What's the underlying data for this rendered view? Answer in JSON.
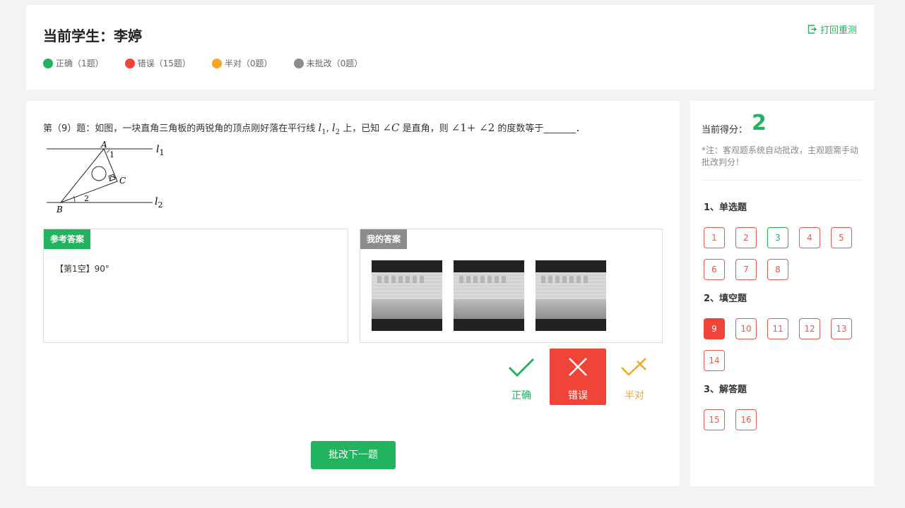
{
  "header": {
    "student_title": "当前学生：李婷",
    "retest_label": "打回重测",
    "legend": [
      {
        "label": "正确（1题）",
        "color": "#22b35e"
      },
      {
        "label": "错误（15题）",
        "color": "#f04438"
      },
      {
        "label": "半对（0题）",
        "color": "#f5a623"
      },
      {
        "label": "未批改（0题）",
        "color": "#8c8c8c"
      }
    ]
  },
  "question": {
    "prefix": "第（9）题：如图，一块直角三角板的两锐角的顶点刚好落在平行线",
    "l1": "l",
    "l1_sub": "1",
    "comma": ",",
    "l2": "l",
    "l2_sub": "2",
    "middle": "上，已知",
    "angle_c": "∠C",
    "middle2": "是直角，则",
    "angle_expr": "∠1+ ∠2",
    "suffix": "的度数等于_______．",
    "figure_labels": {
      "A": "A",
      "B": "B",
      "C": "C",
      "one": "1",
      "two": "2",
      "l": "l",
      "l1_sub": "1",
      "l2_sub": "2"
    }
  },
  "reference": {
    "tag": "参考答案",
    "text": "【第1空】90°"
  },
  "mine": {
    "tag": "我的答案",
    "images": [
      "answer-image-1",
      "answer-image-2",
      "answer-image-3"
    ]
  },
  "grading": {
    "correct_label": "正确",
    "wrong_label": "错误",
    "half_label": "半对",
    "selected": "错误",
    "colors": {
      "correct": "#22b35e",
      "wrong": "#f04438",
      "half": "#f5a623"
    }
  },
  "next_label": "批改下一题",
  "side": {
    "score_label": "当前得分：",
    "score": "2",
    "note": "*注：客观题系统自动批改，主观题需手动批改判分！",
    "sections": [
      {
        "title": "1、单选题",
        "items": [
          {
            "n": "1",
            "status": "wrong"
          },
          {
            "n": "2",
            "status": "wrong"
          },
          {
            "n": "3",
            "status": "correct"
          },
          {
            "n": "4",
            "status": "wrong"
          },
          {
            "n": "5",
            "status": "wrong"
          },
          {
            "n": "6",
            "status": "wrong"
          },
          {
            "n": "7",
            "status": "wrong"
          },
          {
            "n": "8",
            "status": "wrong"
          }
        ]
      },
      {
        "title": "2、填空题",
        "items": [
          {
            "n": "9",
            "status": "current"
          },
          {
            "n": "10",
            "status": "wrong"
          },
          {
            "n": "11",
            "status": "wrong"
          },
          {
            "n": "12",
            "status": "wrong"
          },
          {
            "n": "13",
            "status": "wrong"
          },
          {
            "n": "14",
            "status": "wrong"
          }
        ]
      },
      {
        "title": "3、解答题",
        "items": [
          {
            "n": "15",
            "status": "wrong"
          },
          {
            "n": "16",
            "status": "wrong"
          }
        ]
      }
    ]
  }
}
